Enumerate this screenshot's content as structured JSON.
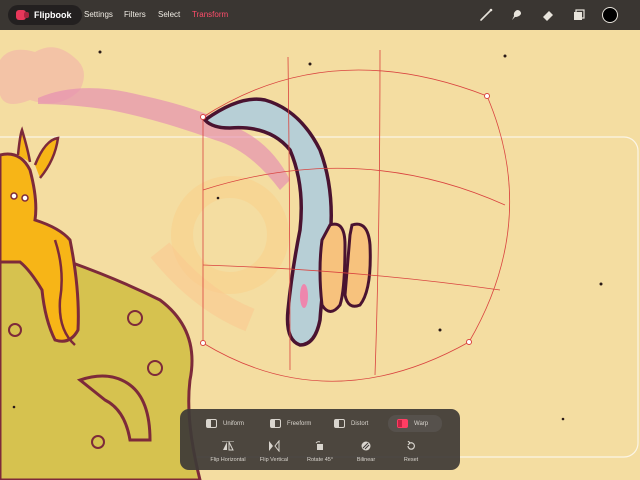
{
  "app": {
    "name": "Flipbook",
    "logo_icon": "flipbook-logo-icon",
    "accent": "#ff4d6b"
  },
  "menu": {
    "items": [
      {
        "label": "Settings",
        "active": false
      },
      {
        "label": "Filters",
        "active": false
      },
      {
        "label": "Select",
        "active": false
      },
      {
        "label": "Transform",
        "active": true
      }
    ]
  },
  "tools": [
    {
      "icon": "brush-icon"
    },
    {
      "icon": "smudge-icon"
    },
    {
      "icon": "eraser-icon"
    },
    {
      "icon": "layers-icon"
    },
    {
      "icon": "color-swatch",
      "color": "#000000"
    }
  ],
  "transform_panel": {
    "modes": [
      {
        "label": "Uniform",
        "active": false
      },
      {
        "label": "Freeform",
        "active": false
      },
      {
        "label": "Distort",
        "active": false
      },
      {
        "label": "Warp",
        "active": true
      }
    ],
    "actions": [
      {
        "label": "Flip Horizontal",
        "icon": "flip-horizontal-icon"
      },
      {
        "label": "Flip Vertical",
        "icon": "flip-vertical-icon"
      },
      {
        "label": "Rotate 45°",
        "icon": "rotate-45-icon"
      },
      {
        "label": "Bilinear",
        "icon": "bilinear-icon"
      },
      {
        "label": "Reset",
        "icon": "reset-icon"
      }
    ]
  },
  "colors": {
    "canvas_bg": "#f4dda1",
    "toolbar_bg": "#3a3632",
    "warp_mesh": "#d9433f"
  }
}
